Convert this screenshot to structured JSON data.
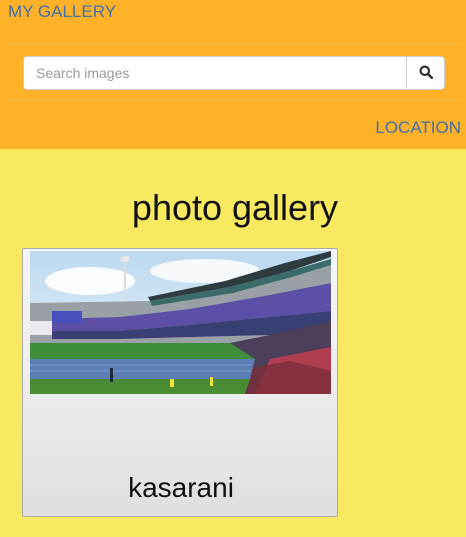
{
  "header": {
    "brand": "MY GALLERY",
    "location_link": "LOCATION"
  },
  "search": {
    "placeholder": "Search images",
    "value": "",
    "button_icon": "search-icon"
  },
  "main": {
    "title": "photo gallery",
    "photos": [
      {
        "caption": "kasarani",
        "image": "stadium-photo"
      }
    ]
  },
  "colors": {
    "navbar": "#ffb228",
    "page_background": "#f8e961",
    "link": "#3f6fad"
  }
}
